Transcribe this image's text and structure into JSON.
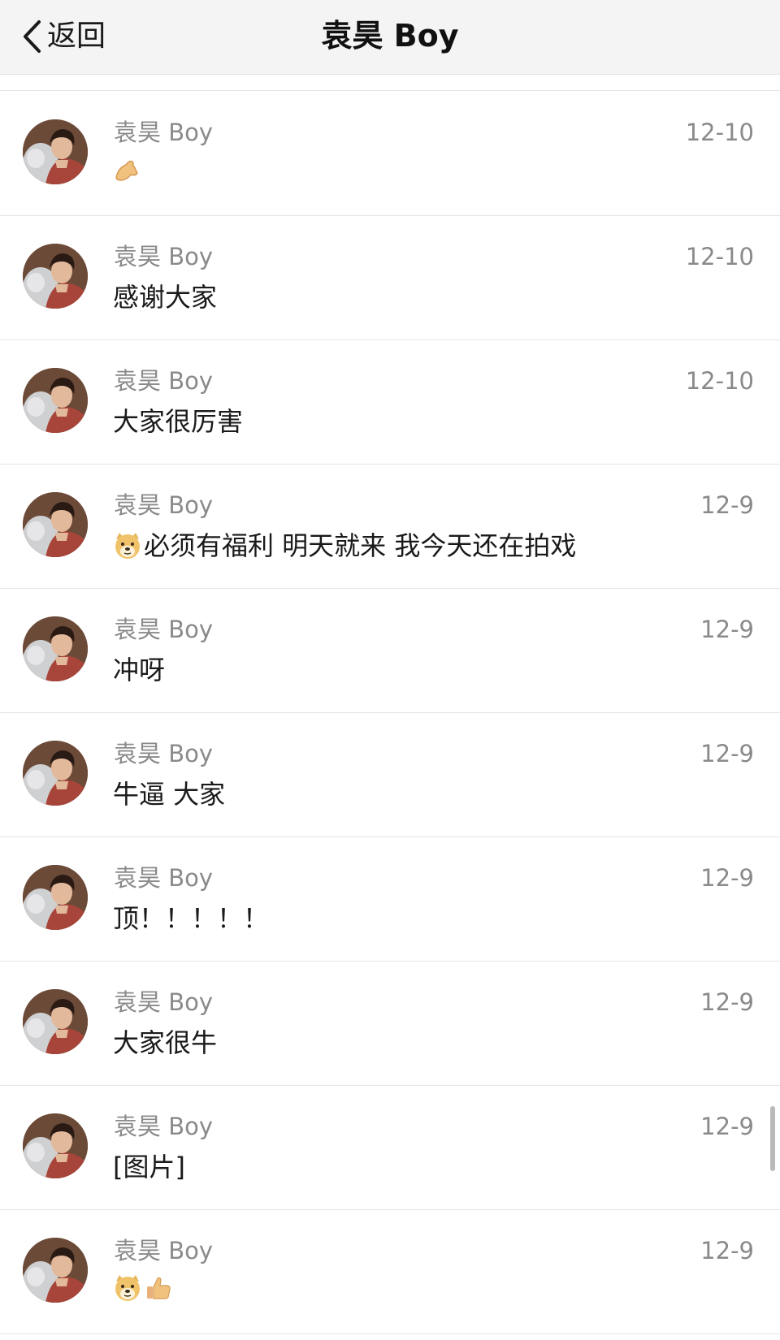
{
  "header": {
    "back_label": "返回",
    "title": "袁昊 Boy"
  },
  "messages": [
    {
      "name": "袁昊 Boy",
      "time": "12-10",
      "text": "",
      "emojis": [
        "pinching-hand-emoji"
      ]
    },
    {
      "name": "袁昊 Boy",
      "time": "12-10",
      "text": "感谢大家",
      "emojis": []
    },
    {
      "name": "袁昊 Boy",
      "time": "12-10",
      "text": "大家很厉害",
      "emojis": []
    },
    {
      "name": "袁昊 Boy",
      "time": "12-9",
      "text": "必须有福利 明天就来 我今天还在拍戏",
      "emojis": [
        "doge-emoji"
      ]
    },
    {
      "name": "袁昊 Boy",
      "time": "12-9",
      "text": "冲呀",
      "emojis": []
    },
    {
      "name": "袁昊 Boy",
      "time": "12-9",
      "text": "牛逼 大家",
      "emojis": []
    },
    {
      "name": "袁昊 Boy",
      "time": "12-9",
      "text": "顶！！！！！",
      "emojis": []
    },
    {
      "name": "袁昊 Boy",
      "time": "12-9",
      "text": "大家很牛",
      "emojis": []
    },
    {
      "name": "袁昊 Boy",
      "time": "12-9",
      "text": "[图片]",
      "emojis": []
    },
    {
      "name": "袁昊 Boy",
      "time": "12-9",
      "text": "",
      "emojis": [
        "doge-emoji",
        "thumbs-up-emoji"
      ]
    }
  ]
}
